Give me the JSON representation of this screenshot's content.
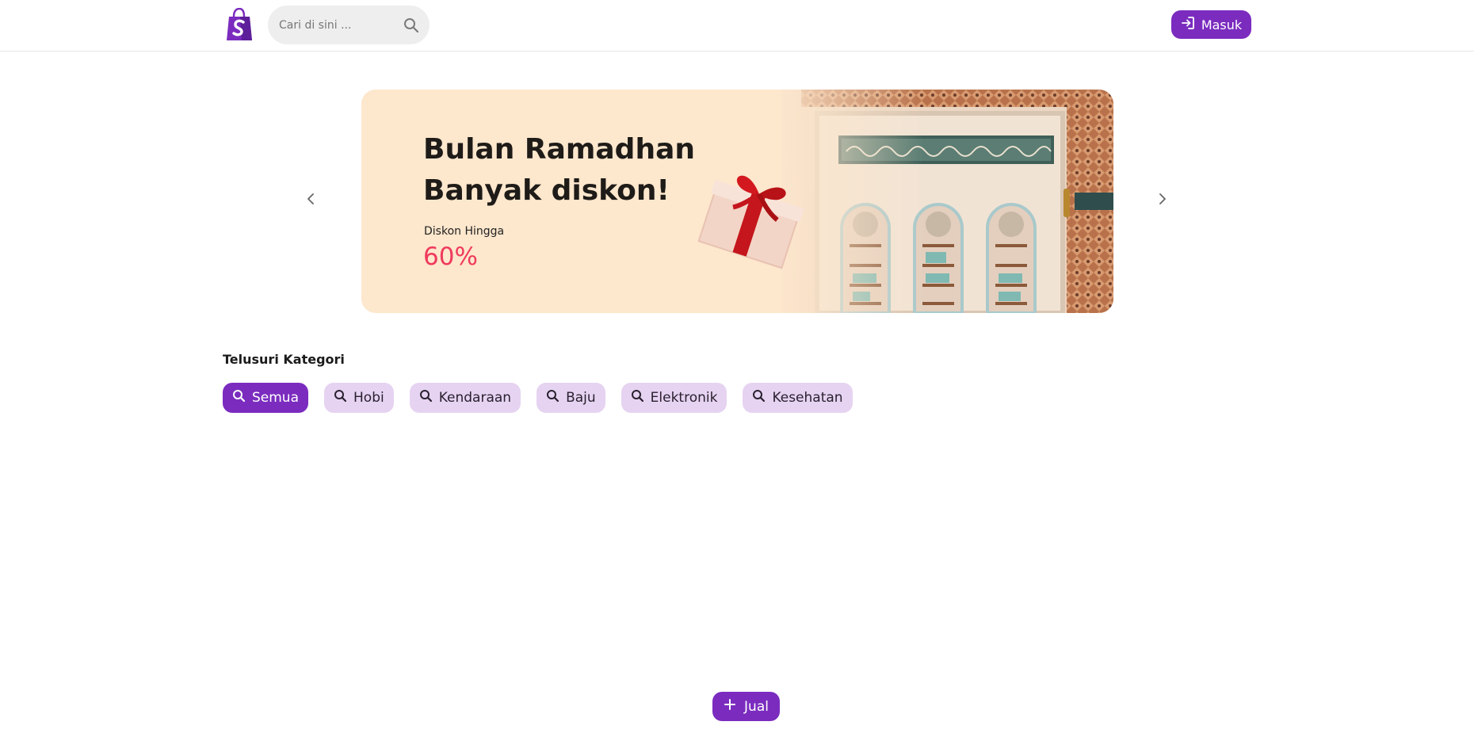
{
  "brand": {
    "logo_icon": "shopping-bag-icon",
    "logo_letter": "S",
    "accent": "#7b2cbf"
  },
  "search": {
    "placeholder": "Cari di sini ...",
    "value": "",
    "icon": "search-icon"
  },
  "header": {
    "login_label": "Masuk",
    "login_icon": "login-icon"
  },
  "carousel": {
    "prev_icon": "chevron-left-icon",
    "next_icon": "chevron-right-icon",
    "banner": {
      "title_line1": "Bulan Ramadhan",
      "title_line2": "Banyak diskon!",
      "subtitle": "Diskon Hingga",
      "discount": "60%",
      "discount_color": "#ef3a5d",
      "background_color": "#fde7cd"
    }
  },
  "categories": {
    "title": "Telusuri Kategori",
    "items": [
      {
        "label": "Semua",
        "active": true
      },
      {
        "label": "Hobi",
        "active": false
      },
      {
        "label": "Kendaraan",
        "active": false
      },
      {
        "label": "Baju",
        "active": false
      },
      {
        "label": "Elektronik",
        "active": false
      },
      {
        "label": "Kesehatan",
        "active": false
      }
    ]
  },
  "sell": {
    "label": "Jual",
    "icon": "plus-icon"
  }
}
